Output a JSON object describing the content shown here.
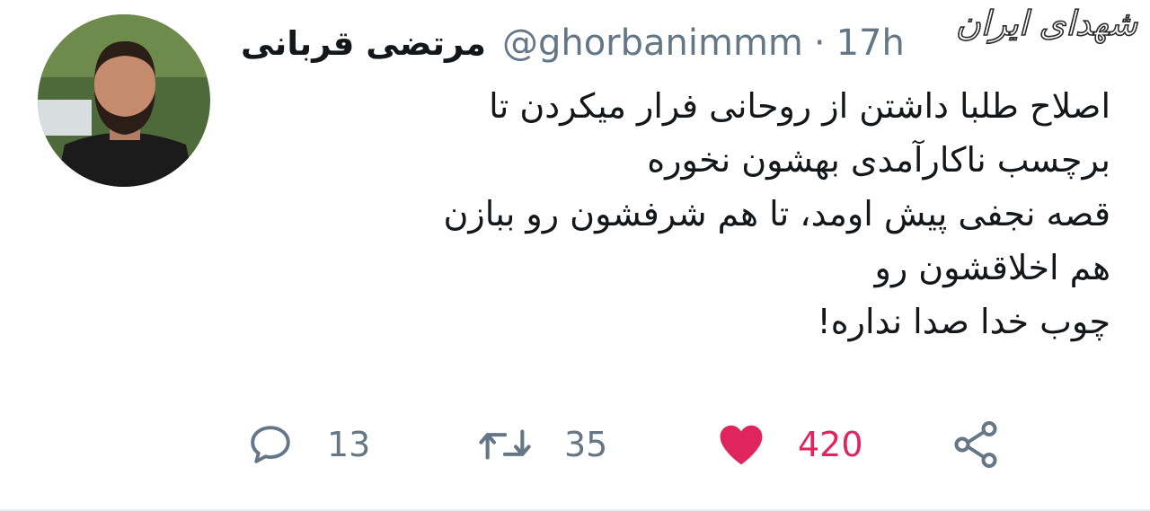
{
  "watermark": "شهدای ایران",
  "tweet": {
    "display_name": "مرتضی قربانی",
    "handle": "@ghorbanimmm",
    "separator": "·",
    "time": "17h",
    "lines": [
      "اصلاح طلبا داشتن از روحانی فرار میکردن تا",
      "برچسب ناکارآمدی بهشون نخوره",
      "قصه نجفی پیش اومد، تا هم شرفشون رو ببازن",
      "هم اخلاقشون رو",
      "چوب خدا صدا نداره!"
    ]
  },
  "actions": {
    "reply_count": "13",
    "retweet_count": "35",
    "like_count": "420"
  },
  "icons": {
    "reply": "reply-icon",
    "retweet": "retweet-icon",
    "like": "heart-icon",
    "share": "share-icon"
  },
  "colors": {
    "text": "#14171a",
    "secondary": "#657786",
    "like": "#e0245e"
  }
}
